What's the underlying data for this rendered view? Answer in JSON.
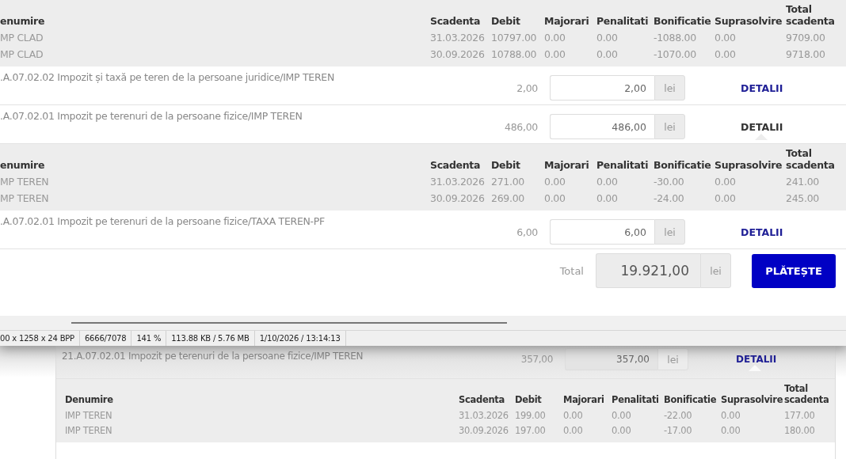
{
  "viewer": {
    "sections": [
      {
        "kind": "details",
        "header": [
          "enumire",
          "Scadenta",
          "Debit",
          "Majorari",
          "Penalitati",
          "Bonificatie",
          "Suprasolvire",
          "Total scadenta"
        ],
        "rows": [
          [
            "MP CLAD",
            "31.03.2026",
            "10797.00",
            "0.00",
            "0.00",
            "-1088.00",
            "0.00",
            "9709.00"
          ],
          [
            "MP CLAD",
            "30.09.2026",
            "10788.00",
            "0.00",
            "0.00",
            "-1070.00",
            "0.00",
            "9718.00"
          ]
        ]
      },
      {
        "kind": "item",
        "description": ".A.07.02.02 Impozit și taxă pe teren de la persoane juridice/IMP TEREN",
        "amount": "2,00",
        "value": "2,00",
        "unit": "lei",
        "link": "DETALII",
        "expanded": false,
        "hovered": false
      },
      {
        "kind": "item",
        "description": ".A.07.02.01 Impozit pe terenuri de la persoane fizice/IMP TEREN",
        "amount": "486,00",
        "value": "486,00",
        "unit": "lei",
        "link": "DETALII",
        "expanded": true,
        "hovered": true
      },
      {
        "kind": "details",
        "header": [
          "enumire",
          "Scadenta",
          "Debit",
          "Majorari",
          "Penalitati",
          "Bonificatie",
          "Suprasolvire",
          "Total scadenta"
        ],
        "rows": [
          [
            "MP TEREN",
            "31.03.2026",
            "271.00",
            "0.00",
            "0.00",
            "-30.00",
            "0.00",
            "241.00"
          ],
          [
            "MP TEREN",
            "30.09.2026",
            "269.00",
            "0.00",
            "0.00",
            "-24.00",
            "0.00",
            "245.00"
          ]
        ]
      },
      {
        "kind": "item",
        "description": ".A.07.02.01 Impozit pe terenuri de la persoane fizice/TAXA TEREN-PF",
        "amount": "6,00",
        "value": "6,00",
        "unit": "lei",
        "link": "DETALII",
        "expanded": false,
        "hovered": false
      },
      {
        "kind": "total",
        "label": "Total",
        "value": "19.921,00",
        "unit": "lei",
        "button": "PLĂTEȘTE"
      }
    ],
    "status_bar": [
      "00 x 1258 x 24 BPP",
      "6666/7078",
      "141 %",
      "113.88 KB / 5.76 MB",
      "1/10/2026 / 13:14:13"
    ]
  },
  "background_page": {
    "sections": [
      {
        "kind": "item",
        "description": "21.A.07.02.01 Impozit pe terenuri de la persoane fizice/IMP TEREN",
        "amount": "357,00",
        "value": "357,00",
        "unit": "lei",
        "link": "DETALII",
        "expanded": true,
        "hovered": false
      },
      {
        "kind": "details",
        "header": [
          "Denumire",
          "Scadenta",
          "Debit",
          "Majorari",
          "Penalitati",
          "Bonificatie",
          "Suprasolvire",
          "Total scadenta"
        ],
        "rows": [
          [
            "IMP TEREN",
            "31.03.2026",
            "199.00",
            "0.00",
            "0.00",
            "-22.00",
            "0.00",
            "177.00"
          ],
          [
            "IMP TEREN",
            "30.09.2026",
            "197.00",
            "0.00",
            "0.00",
            "-17.00",
            "0.00",
            "180.00"
          ]
        ]
      }
    ]
  }
}
